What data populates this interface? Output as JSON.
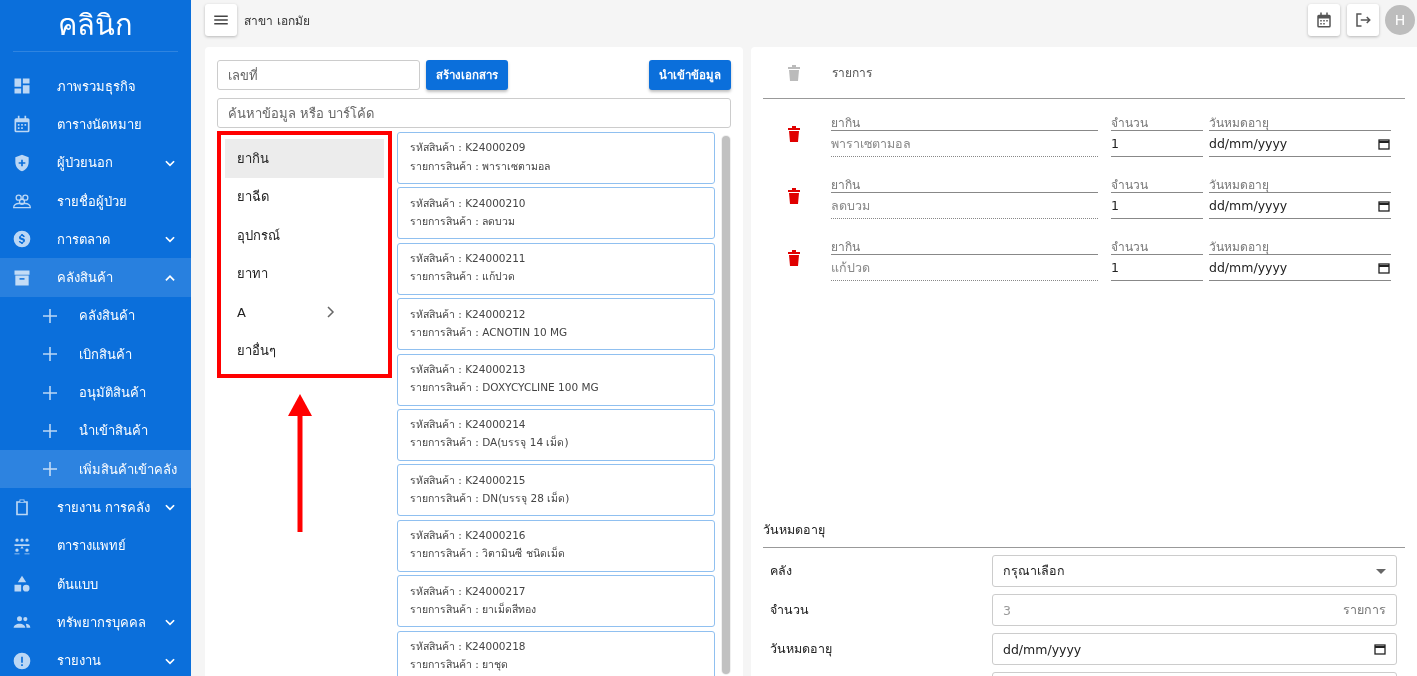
{
  "topbar": {
    "branch": "สาขา เอกมัย",
    "avatar": "H"
  },
  "sidebar": {
    "title": "คลินิก",
    "items": [
      {
        "label": "ภาพรวมธุรกิจ",
        "kind": "link",
        "selected": false
      },
      {
        "label": "ตารางนัดหมาย",
        "kind": "link",
        "selected": false
      },
      {
        "label": "ผู้ป่วยนอก",
        "kind": "group",
        "expanded": false,
        "selected": false
      },
      {
        "label": "รายชื่อผู้ป่วย",
        "kind": "link",
        "selected": false
      },
      {
        "label": "การตลาด",
        "kind": "group",
        "expanded": false,
        "selected": false
      },
      {
        "label": "คลังสินค้า",
        "kind": "group",
        "expanded": true,
        "selected": false,
        "children": [
          {
            "label": "คลังสินค้า",
            "selected": false
          },
          {
            "label": "เบิกสินค้า",
            "selected": false
          },
          {
            "label": "อนุมัติสินค้า",
            "selected": false
          },
          {
            "label": "นำเข้าสินค้า",
            "selected": false
          },
          {
            "label": "เพิ่มสินค้าเข้าคลัง",
            "selected": true
          }
        ]
      },
      {
        "label": "รายงาน การคลัง",
        "kind": "group",
        "expanded": false,
        "selected": false
      },
      {
        "label": "ตารางแพทย์",
        "kind": "link",
        "selected": false
      },
      {
        "label": "ต้นแบบ",
        "kind": "link",
        "selected": false
      },
      {
        "label": "ทรัพยากรบุคคล",
        "kind": "group",
        "expanded": false,
        "selected": false
      },
      {
        "label": "รายงาน",
        "kind": "group",
        "expanded": false,
        "selected": false
      }
    ]
  },
  "picker": {
    "doc_number": {
      "placeholder": "เลขที่"
    },
    "create_button": "สร้างเอกสาร",
    "import_button": "นำเข้าข้อมูล",
    "search": {
      "placeholder": "ค้นหาข้อมูล หรือ บาร์โค้ด"
    },
    "categories": [
      {
        "label": "ยากิน",
        "selected": true,
        "submenu": false
      },
      {
        "label": "ยาฉีด",
        "selected": false,
        "submenu": false
      },
      {
        "label": "อุปกรณ์",
        "selected": false,
        "submenu": false
      },
      {
        "label": "ยาทา",
        "selected": false,
        "submenu": false
      },
      {
        "label": "A",
        "selected": false,
        "submenu": true
      },
      {
        "label": "ยาอื่นๆ",
        "selected": false,
        "submenu": false
      }
    ],
    "products": [
      {
        "code": "รหัสสินค้า : K24000209",
        "name": "รายการสินค้า : พาราเซตามอล"
      },
      {
        "code": "รหัสสินค้า : K24000210",
        "name": "รายการสินค้า : ลดบวม"
      },
      {
        "code": "รหัสสินค้า : K24000211",
        "name": "รายการสินค้า : แก้ปวด"
      },
      {
        "code": "รหัสสินค้า : K24000212",
        "name": "รายการสินค้า : ACNOTIN 10 MG"
      },
      {
        "code": "รหัสสินค้า : K24000213",
        "name": "รายการสินค้า : DOXYCYCLINE 100 MG"
      },
      {
        "code": "รหัสสินค้า : K24000214",
        "name": "รายการสินค้า : DA(บรรจุ 14 เม็ด)"
      },
      {
        "code": "รหัสสินค้า : K24000215",
        "name": "รายการสินค้า : DN(บรรจุ 28 เม็ด)"
      },
      {
        "code": "รหัสสินค้า : K24000216",
        "name": "รายการสินค้า : วิตามินซี ชนิดเม็ด"
      },
      {
        "code": "รหัสสินค้า : K24000217",
        "name": "รายการสินค้า : ยาเม็ดสีทอง"
      },
      {
        "code": "รหัสสินค้า : K24000218",
        "name": "รายการสินค้า : ยาชุด"
      }
    ]
  },
  "order": {
    "header": "รายการ",
    "lines": [
      {
        "category": "ยากิน",
        "name": "พาราเซตามอล",
        "qty_label": "จำนวน",
        "qty": "1",
        "expiry_label": "วันหมดอายุ",
        "expiry": "dd/mm/yyyy"
      },
      {
        "category": "ยากิน",
        "name": "ลดบวม",
        "qty_label": "จำนวน",
        "qty": "1",
        "expiry_label": "วันหมดอายุ",
        "expiry": "dd/mm/yyyy"
      },
      {
        "category": "ยากิน",
        "name": "แก้ปวด",
        "qty_label": "จำนวน",
        "qty": "1",
        "expiry_label": "วันหมดอายุ",
        "expiry": "dd/mm/yyyy"
      }
    ],
    "section_title": "วันหมดอายุ",
    "form": [
      {
        "kind": "select",
        "label": "คลัง",
        "value": "กรุณาเลือก"
      },
      {
        "kind": "number",
        "label": "จำนวน",
        "placeholder": "3",
        "suffix": "รายการ"
      },
      {
        "kind": "date",
        "label": "วันหมดอายุ",
        "value": "dd/mm/yyyy"
      },
      {
        "kind": "text"
      }
    ]
  }
}
